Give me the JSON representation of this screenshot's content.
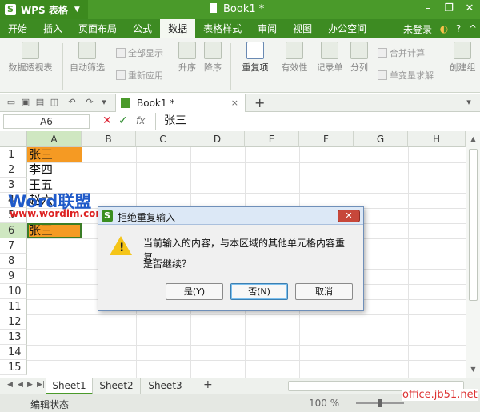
{
  "titlebar": {
    "app_logo": "S",
    "app_name": "WPS 表格",
    "doc_title": "Book1 *"
  },
  "menubar": {
    "items": [
      "开始",
      "插入",
      "页面布局",
      "公式",
      "数据",
      "表格样式",
      "审阅",
      "视图",
      "办公空间"
    ],
    "active_index": 4,
    "login": "未登录"
  },
  "ribbon": {
    "pivot": "数据透视表",
    "autofilter": "自动筛选",
    "show_all": "全部显示",
    "reapply": "重新应用",
    "sort_asc": "升序",
    "sort_desc": "降序",
    "duplicates": "重复项",
    "validity": "有效性",
    "record": "记录单",
    "split": "分列",
    "merge_calc": "合并计算",
    "single_var": "单变量求解",
    "create_group": "创建组"
  },
  "tabs": {
    "book": "Book1 *",
    "book_close": "×",
    "add": "+"
  },
  "formula_bar": {
    "namebox": "A6",
    "cancel": "✕",
    "enter": "✓",
    "fx": "fx",
    "value": "张三"
  },
  "columns": [
    "A",
    "B",
    "C",
    "D",
    "E",
    "F",
    "G",
    "H"
  ],
  "rows": [
    "1",
    "2",
    "3",
    "4",
    "5",
    "6",
    "7",
    "8",
    "9",
    "10",
    "11",
    "12",
    "13",
    "14",
    "15"
  ],
  "cells": {
    "a1": "张三",
    "a2": "李四",
    "a3": "王五",
    "a4": "赵六",
    "a6": "张三"
  },
  "highlight_color": "#f59a23",
  "watermark": {
    "word": "Word",
    "cn": "联盟",
    "url": "www.wordlm.com",
    "site": "office.jb51.net"
  },
  "sheets": [
    "Sheet1",
    "Sheet2",
    "Sheet3"
  ],
  "active_sheet": 0,
  "statusbar": {
    "text": "编辑状态",
    "zoom": "100 %"
  },
  "dialog": {
    "title": "拒绝重复输入",
    "logo": "S",
    "close": "✕",
    "message": "当前输入的内容，与本区域的其他单元格内容重复。",
    "question": "是否继续？",
    "yes": "是(Y)",
    "no": "否(N)",
    "cancel": "取消"
  }
}
